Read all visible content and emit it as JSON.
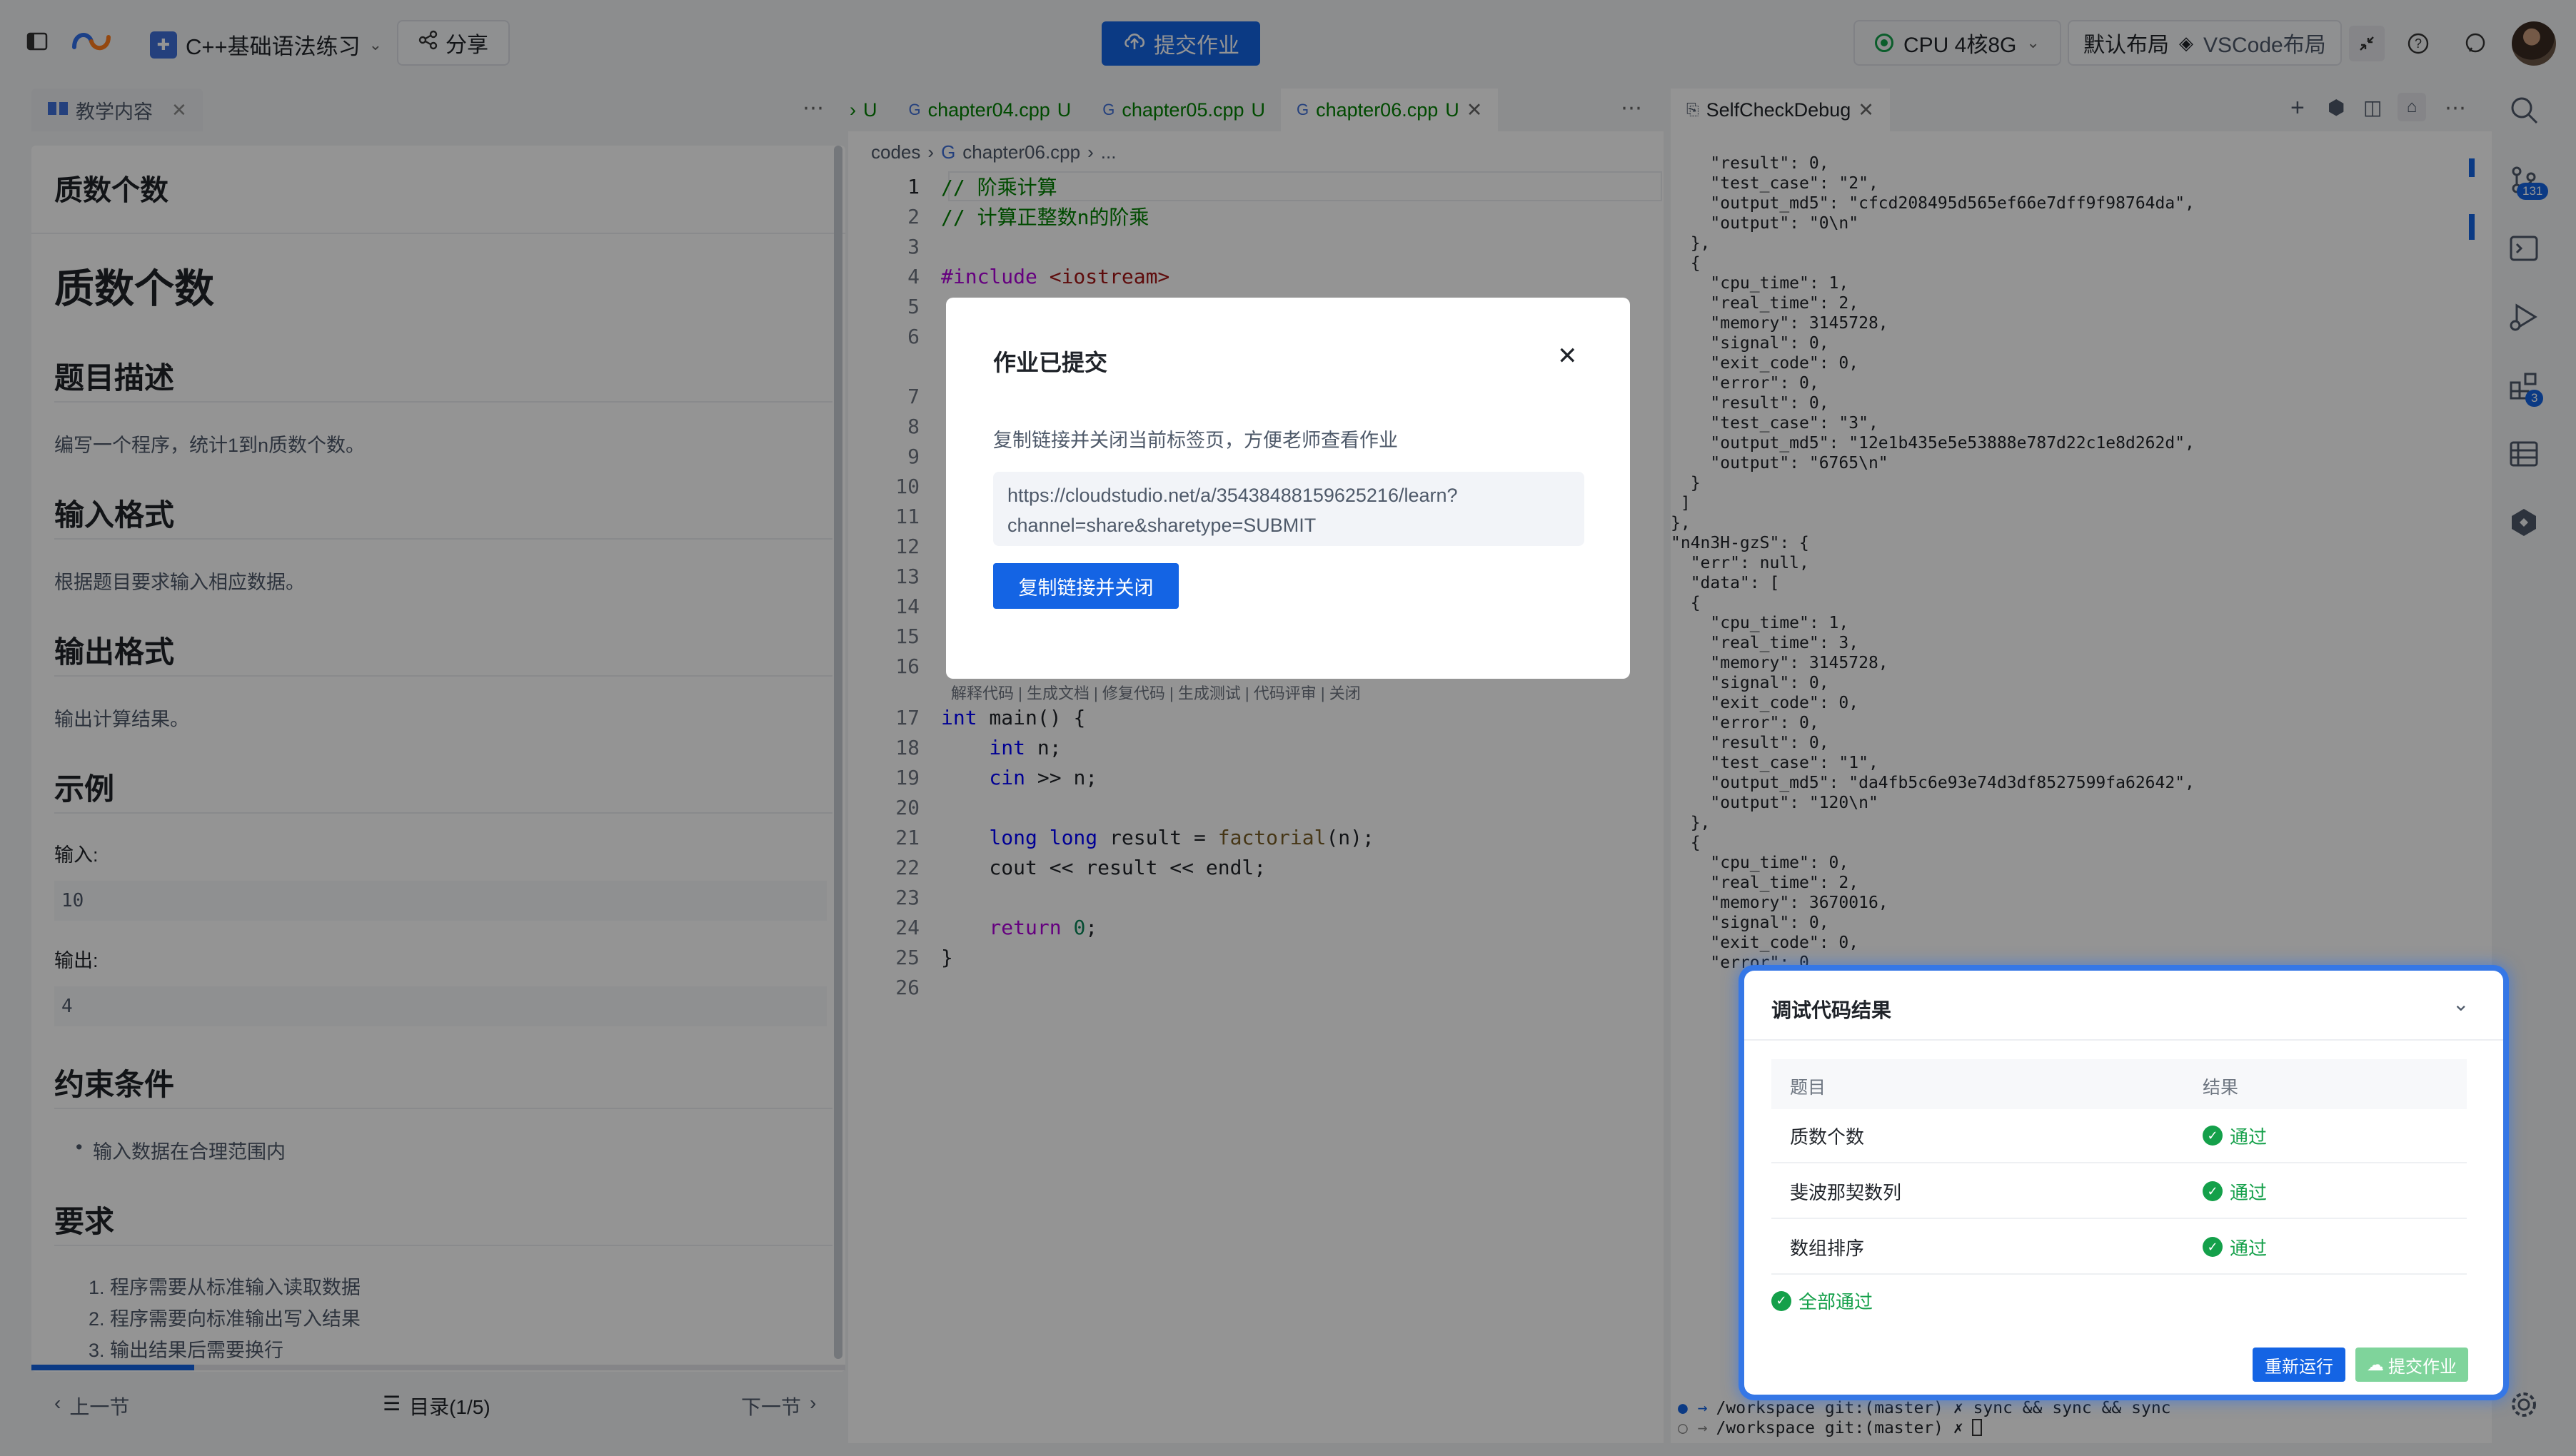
{
  "topbar": {
    "project_name": "C++基础语法练习",
    "share_label": "分享",
    "submit_label": "提交作业",
    "cpu_label": "CPU 4核8G",
    "layout_default": "默认布局",
    "layout_vscode": "VSCode布局"
  },
  "left": {
    "tab_label": "教学内容",
    "page_title": "质数个数",
    "h1": "质数个数",
    "desc_title": "题目描述",
    "desc": "编写一个程序，统计1到n质数个数。",
    "input_title": "输入格式",
    "input_desc": "根据题目要求输入相应数据。",
    "output_title": "输出格式",
    "output_desc": "输出计算结果。",
    "example_title": "示例",
    "example_in_label": "输入:",
    "example_in": "10",
    "example_out_label": "输出:",
    "example_out": "4",
    "constraint_title": "约束条件",
    "constraint_1": "输入数据在合理范围内",
    "req_title": "要求",
    "req_1": "1. 程序需要从标准输入读取数据",
    "req_2": "2. 程序需要向标准输出写入结果",
    "req_3": "3. 输出结果后需要换行",
    "prev": "上一节",
    "toc": "目录(1/5)",
    "next": "下一节"
  },
  "editor": {
    "tab_partial": "U",
    "tab1": "chapter04.cpp",
    "tab2": "chapter05.cpp",
    "tab3": "chapter06.cpp",
    "tab_status": "U",
    "breadcrumb_root": "codes",
    "breadcrumb_file": "chapter06.cpp",
    "breadcrumb_more": "...",
    "codelens": "解释代码 | 生成文档 | 修复代码 | 生成测试 | 代码评审 | 关闭",
    "lines": {
      "l1": "// 阶乘计算",
      "l2": "// 计算正整数n的阶乘",
      "l4a": "#include ",
      "l4b": "<iostream>",
      "l17a": "int",
      "l17b": " main() {",
      "l18a": "    int",
      "l18b": " n;",
      "l19a": "    cin",
      "l19b": " >> n;",
      "l21a": "    long long",
      "l21b": " result = ",
      "l21c": "factorial",
      "l21d": "(n);",
      "l22": "    cout << result << endl;",
      "l24a": "    return ",
      "l24b": "0",
      "l24c": ";",
      "l25": "}"
    }
  },
  "right": {
    "tab_label": "SelfCheckDebug",
    "json_text": "    \"result\": 0,\n    \"test_case\": \"2\",\n    \"output_md5\": \"cfcd208495d565ef66e7dff9f98764da\",\n    \"output\": \"0\\n\"\n  },\n  {\n    \"cpu_time\": 1,\n    \"real_time\": 2,\n    \"memory\": 3145728,\n    \"signal\": 0,\n    \"exit_code\": 0,\n    \"error\": 0,\n    \"result\": 0,\n    \"test_case\": \"3\",\n    \"output_md5\": \"12e1b435e5e53888e787d22c1e8d262d\",\n    \"output\": \"6765\\n\"\n  }\n ]\n},\n\"n4n3H-gzS\": {\n  \"err\": null,\n  \"data\": [\n  {\n    \"cpu_time\": 1,\n    \"real_time\": 3,\n    \"memory\": 3145728,\n    \"signal\": 0,\n    \"exit_code\": 0,\n    \"error\": 0,\n    \"result\": 0,\n    \"test_case\": \"1\",\n    \"output_md5\": \"da4fb5c6e93e74d3df8527599fa62642\",\n    \"output\": \"120\\n\"\n  },\n  {\n    \"cpu_time\": 0,\n    \"real_time\": 2,\n    \"memory\": 3670016,\n    \"signal\": 0,\n    \"exit_code\": 0,\n    \"error\": 0,",
    "term_line1": "/workspace git:(master) ✗ sync && sync && sync",
    "term_line2": "/workspace git:(master) ✗ "
  },
  "activity": {
    "scm_badge": "131",
    "ext_badge": "3"
  },
  "modal": {
    "title": "作业已提交",
    "desc": "复制链接并关闭当前标签页，方便老师查看作业",
    "url_line1": "https://cloudstudio.net/a/35438488159625216/learn?",
    "url_line2": "channel=share&sharetype=SUBMIT",
    "button": "复制链接并关闭"
  },
  "result": {
    "title": "调试代码结果",
    "col_topic": "题目",
    "col_result": "结果",
    "rows": [
      {
        "topic": "质数个数",
        "status": "通过"
      },
      {
        "topic": "斐波那契数列",
        "status": "通过"
      },
      {
        "topic": "数组排序",
        "status": "通过"
      }
    ],
    "all_pass": "全部通过",
    "rerun": "重新运行",
    "submit": "提交作业"
  }
}
